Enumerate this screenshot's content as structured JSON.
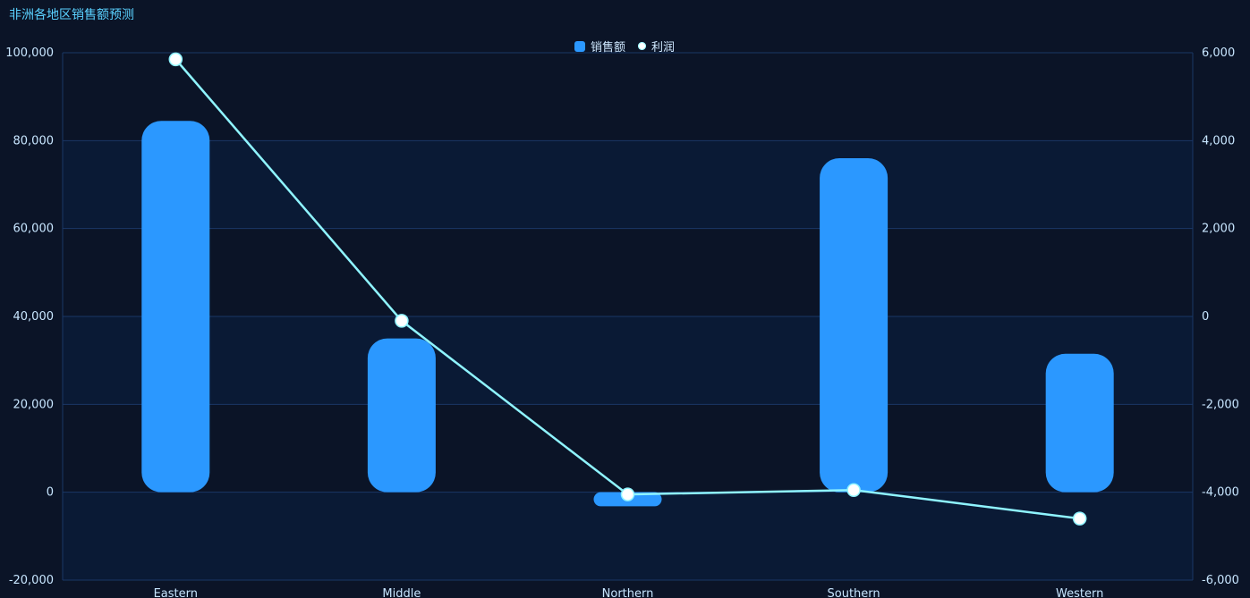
{
  "title": "非洲各地区销售额预测",
  "legend": [
    {
      "name": "销售额",
      "type": "bar"
    },
    {
      "name": "利润",
      "type": "line"
    }
  ],
  "colors": {
    "background": "#0b1427",
    "band_alt": "#0a1a35",
    "bar": "#2b98ff",
    "line": "#8ff4ff",
    "grid": "#1a3766",
    "title": "#5ad1ff"
  },
  "chart_data": {
    "type": "bar",
    "title": "非洲各地区销售额预测",
    "categories": [
      "Eastern",
      "Middle",
      "Northern",
      "Southern",
      "Western"
    ],
    "series": [
      {
        "name": "销售额",
        "type": "bar",
        "axis": "left",
        "values": [
          84500,
          35000,
          -3200,
          76000,
          31500
        ]
      },
      {
        "name": "利润",
        "type": "line",
        "axis": "right",
        "values": [
          5850,
          -100,
          -4050,
          -3950,
          -4600
        ]
      }
    ],
    "y_left": {
      "min": -20000,
      "max": 100000,
      "ticks": [
        "-20,000",
        "0",
        "20,000",
        "40,000",
        "60,000",
        "80,000",
        "100,000"
      ]
    },
    "y_right": {
      "min": -6000,
      "max": 6000,
      "ticks": [
        "-6,000",
        "-4,000",
        "-2,000",
        "0",
        "2,000",
        "4,000",
        "6,000"
      ]
    },
    "grid": true,
    "legend_position": "top-center"
  }
}
